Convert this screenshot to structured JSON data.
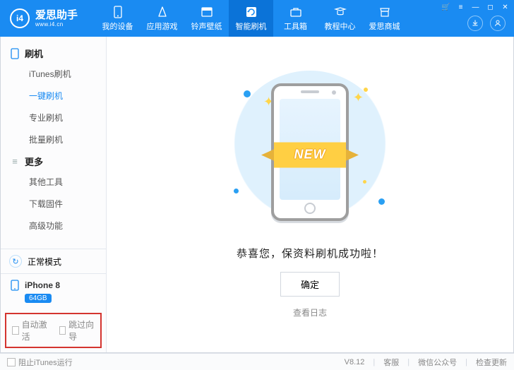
{
  "brand": {
    "name": "爱思助手",
    "site": "www.i4.cn",
    "badge": "i4"
  },
  "nav": {
    "items": [
      {
        "label": "我的设备"
      },
      {
        "label": "应用游戏"
      },
      {
        "label": "铃声壁纸"
      },
      {
        "label": "智能刷机"
      },
      {
        "label": "工具箱"
      },
      {
        "label": "教程中心"
      },
      {
        "label": "爱思商城"
      }
    ],
    "activeIndex": 3
  },
  "sidebar": {
    "sections": [
      {
        "title": "刷机",
        "items": [
          "iTunes刷机",
          "一键刷机",
          "专业刷机",
          "批量刷机"
        ],
        "activeIndex": 1
      },
      {
        "title": "更多",
        "items": [
          "其他工具",
          "下载固件",
          "高级功能"
        ]
      }
    ],
    "mode": "正常模式",
    "device": {
      "model": "iPhone 8",
      "storage": "64GB"
    },
    "checkA": "自动激活",
    "checkB": "跳过向导"
  },
  "result": {
    "ribbon": "NEW",
    "message": "恭喜您，保资料刷机成功啦！",
    "confirm": "确定",
    "logLink": "查看日志"
  },
  "footer": {
    "blockItunes": "阻止iTunes运行",
    "version": "V8.12",
    "service": "客服",
    "wechat": "微信公众号",
    "update": "检查更新"
  }
}
